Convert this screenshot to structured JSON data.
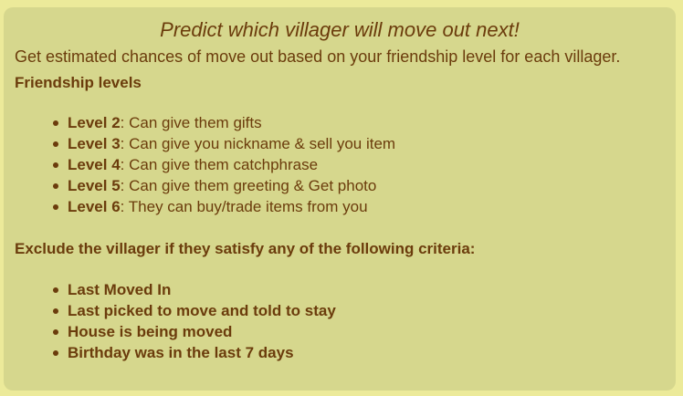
{
  "title": "Predict which villager will move out next!",
  "subtitle": "Get estimated chances of move out based on your friendship level for each villager.",
  "friendship": {
    "heading": "Friendship levels",
    "items": [
      {
        "level": "Level 2",
        "desc": ": Can give them gifts"
      },
      {
        "level": "Level 3",
        "desc": ": Can give you nickname & sell you item"
      },
      {
        "level": "Level 4",
        "desc": ": Can give them catchphrase"
      },
      {
        "level": "Level 5",
        "desc": ": Can give them greeting & Get photo"
      },
      {
        "level": "Level 6",
        "desc": ": They can buy/trade items from you"
      }
    ]
  },
  "exclude": {
    "heading": "Exclude the villager if they satisfy any of the following criteria:",
    "items": [
      "Last Moved In",
      "Last picked to move and told to stay",
      "House is being moved",
      "Birthday was in the last 7 days"
    ]
  },
  "colors": {
    "page_background": "#ecea9a",
    "panel_background": "#d6d78d",
    "text": "#6b3c0c"
  }
}
